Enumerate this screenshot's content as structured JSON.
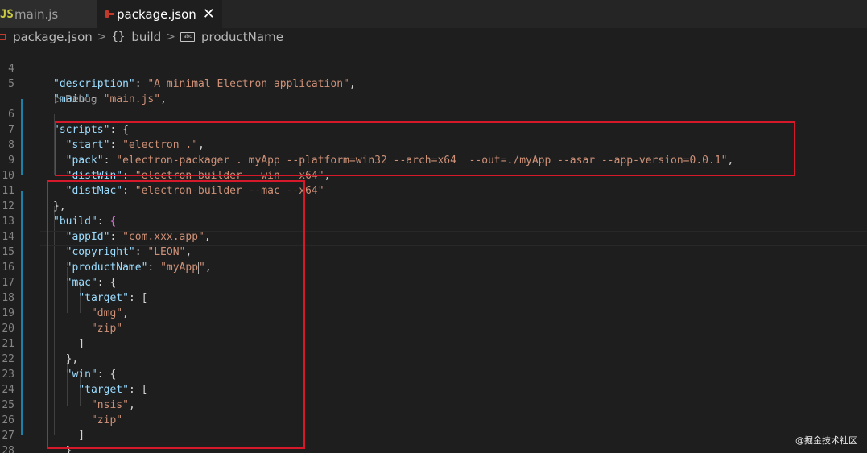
{
  "tabs": [
    {
      "icon": "JS",
      "label": "main.js"
    },
    {
      "label": "package.json",
      "close": "✕"
    }
  ],
  "breadcrumb": {
    "file": "package.json",
    "separator": ">",
    "node_icon": "{}",
    "node": "build",
    "leaf_icon": "abc",
    "leaf": "productName"
  },
  "codelens": "▷ Debug",
  "watermark": "@掘金技术社区",
  "line_numbers": [
    "4",
    "5",
    "6",
    "7",
    "8",
    "9",
    "10",
    "11",
    "12",
    "13",
    "14",
    "15",
    "16",
    "17",
    "18",
    "19",
    "20",
    "21",
    "22",
    "23",
    "24",
    "25",
    "26",
    "27",
    "28"
  ],
  "code": {
    "l4": {
      "key": "\"description\"",
      "val": "\"A minimal Electron application\""
    },
    "l5": {
      "key": "\"main\"",
      "val": "\"main.js\""
    },
    "l6": {
      "key": "\"scripts\""
    },
    "l7": {
      "key": "\"start\"",
      "val": "\"electron .\""
    },
    "l8": {
      "key": "\"pack\"",
      "val": "\"electron-packager . myApp --platform=win32 --arch=x64  --out=./myApp --asar --app-version=0.0.1\""
    },
    "l9": {
      "key": "\"distWin\"",
      "val": "\"electron-builder --win --x64\""
    },
    "l10": {
      "key": "\"distMac\"",
      "val": "\"electron-builder --mac --x64\""
    },
    "l12": {
      "key": "\"build\""
    },
    "l13": {
      "key": "\"appId\"",
      "val": "\"com.xxx.app\""
    },
    "l14": {
      "key": "\"copyright\"",
      "val": "\"LEON\""
    },
    "l15": {
      "key": "\"productName\"",
      "val_a": "\"myApp",
      "val_b": "\""
    },
    "l16": {
      "key": "\"mac\""
    },
    "l17": {
      "key": "\"target\""
    },
    "l18": {
      "val": "\"dmg\""
    },
    "l19": {
      "val": "\"zip\""
    },
    "l22": {
      "key": "\"win\""
    },
    "l23": {
      "key": "\"target\""
    },
    "l24": {
      "val": "\"nsis\""
    },
    "l25": {
      "val": "\"zip\""
    }
  },
  "colors": {
    "highlight_box": "#d6182b",
    "string": "#ce9178",
    "key": "#9cdcfe"
  }
}
